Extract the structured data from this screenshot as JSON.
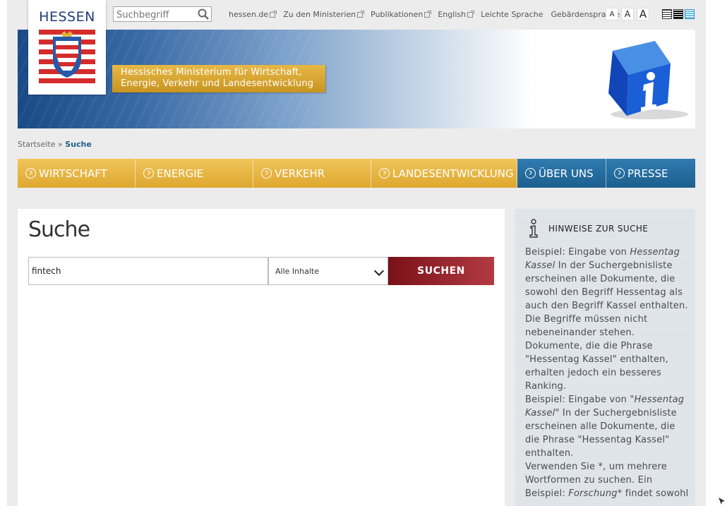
{
  "header": {
    "logo_text": "HESSEN",
    "search_placeholder": "Suchbegriff",
    "service_links": [
      "hessen.de",
      "Zu den Ministerien",
      "Publikationen",
      "English",
      "Leichte Sprache",
      "Gebärdensprache"
    ],
    "font_sizes": [
      "A",
      "A",
      "A"
    ]
  },
  "banner": {
    "ministry_line1": "Hessisches Ministerium für Wirtschaft,",
    "ministry_line2": "Energie, Verkehr und Landesentwicklung"
  },
  "breadcrumb": {
    "home": "Startseite",
    "separator": "»",
    "current": "Suche"
  },
  "nav": [
    {
      "label": "WIRTSCHAFT",
      "style": "gold"
    },
    {
      "label": "ENERGIE",
      "style": "gold"
    },
    {
      "label": "VERKEHR",
      "style": "gold"
    },
    {
      "label": "LANDESENTWICKLUNG",
      "style": "gold"
    },
    {
      "label": "ÜBER UNS",
      "style": "blue"
    },
    {
      "label": "PRESSE",
      "style": "blue"
    }
  ],
  "main": {
    "title": "Suche",
    "query_value": "fintech",
    "select_value": "Alle Inhalte",
    "button_label": "SUCHEN"
  },
  "sidebar": {
    "title": "HINWEISE ZUR SUCHE",
    "p1_a": "Beispiel: Eingabe von ",
    "p1_em": "Hessentag Kassel",
    "p1_b": " In der Suchergebnisliste erscheinen alle Dokumente, die sowohl den Begriff Hessentag als auch den Begriff Kassel enthalten. Die Begriffe müssen nicht nebeneinander stehen. Dokumente, die die Phrase \"Hessentag Kassel\" enthalten, erhalten jedoch ein besseres Ranking.",
    "p2_a": "Beispiel: Eingabe von ",
    "p2_em": "\"Hessentag Kassel\"",
    "p2_b": " In der Suchergebnisliste erscheinen alle Dokumente, die die Phrase \"Hessentag Kassel\" enthalten.",
    "p3_a": "Verwenden Sie *, um mehrere Wortformen zu suchen. Ein Beispiel: ",
    "p3_em": "Forschung*",
    "p3_b": " findet sowohl"
  },
  "colors": {
    "gold_nav": "#dea72f",
    "blue_nav": "#1c5f8e",
    "search_button": "#8a1e25",
    "logo_blue": "#1f3c78"
  }
}
